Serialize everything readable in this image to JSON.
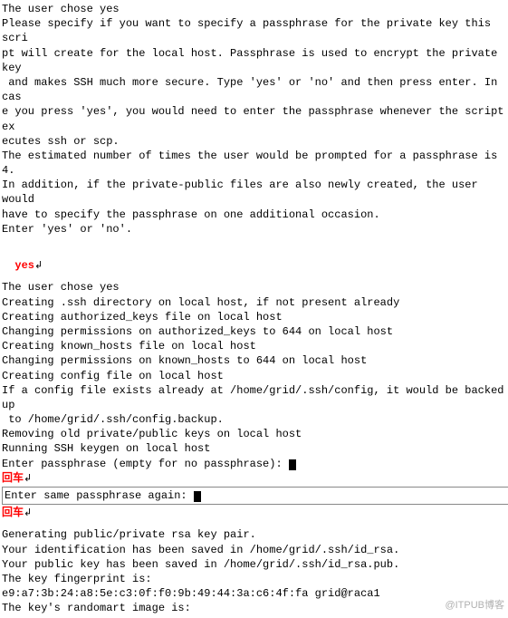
{
  "block1": [
    "The user chose yes",
    "Please specify if you want to specify a passphrase for the private key this scri",
    "pt will create for the local host. Passphrase is used to encrypt the private key",
    " and makes SSH much more secure. Type 'yes' or 'no' and then press enter. In cas",
    "e you press 'yes', you would need to enter the passphrase whenever the script ex",
    "ecutes ssh or scp.",
    "The estimated number of times the user would be prompted for a passphrase is 4.",
    "In addition, if the private-public files are also newly created, the user would",
    "have to specify the passphrase on one additional occasion.",
    "Enter 'yes' or 'no'."
  ],
  "input1": "yes",
  "block2": [
    "The user chose yes",
    "Creating .ssh directory on local host, if not present already",
    "Creating authorized_keys file on local host",
    "Changing permissions on authorized_keys to 644 on local host",
    "Creating known_hosts file on local host",
    "Changing permissions on known_hosts to 644 on local host",
    "Creating config file on local host",
    "If a config file exists already at /home/grid/.ssh/config, it would be backed up",
    " to /home/grid/.ssh/config.backup.",
    "Removing old private/public keys on local host",
    "Running SSH keygen on local host"
  ],
  "prompt1": "Enter passphrase (empty for no passphrase): ",
  "label1": "回车",
  "prompt2": "Enter same passphrase again: ",
  "label2": "回车",
  "block3": [
    "Generating public/private rsa key pair.",
    "Your identification has been saved in /home/grid/.ssh/id_rsa.",
    "Your public key has been saved in /home/grid/.ssh/id_rsa.pub.",
    "The key fingerprint is:",
    "e9:a7:3b:24:a8:5e:c3:0f:f0:9b:49:44:3a:c6:4f:fa grid@raca1",
    "The key's randomart image is:"
  ],
  "watermark": "@ITPUB博客"
}
